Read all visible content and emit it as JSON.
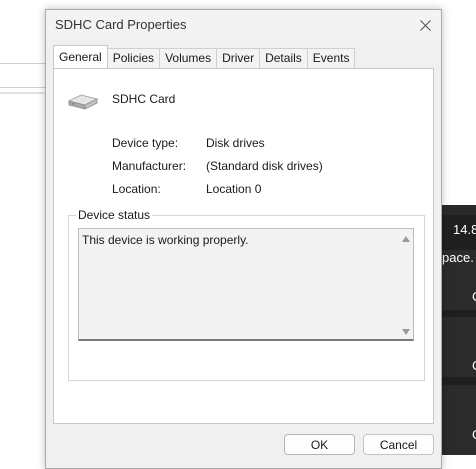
{
  "dialog": {
    "title": "SDHC Card Properties",
    "tabs": [
      {
        "label": "General",
        "active": true
      },
      {
        "label": "Policies"
      },
      {
        "label": "Volumes"
      },
      {
        "label": "Driver"
      },
      {
        "label": "Details"
      },
      {
        "label": "Events"
      }
    ],
    "device_name": "SDHC Card",
    "device_icon": "disk-drive-icon",
    "properties": [
      {
        "label": "Device type:",
        "value": "Disk drives"
      },
      {
        "label": "Manufacturer:",
        "value": "(Standard disk drives)"
      },
      {
        "label": "Location:",
        "value": "Location 0"
      }
    ],
    "status_group_title": "Device status",
    "status_text": "This device is working properly.",
    "ok_label": "OK",
    "cancel_label": "Cancel"
  },
  "background": {
    "right_value": "14.8",
    "right_text": "pace.",
    "right_letters": [
      "C",
      "C",
      "C"
    ]
  }
}
